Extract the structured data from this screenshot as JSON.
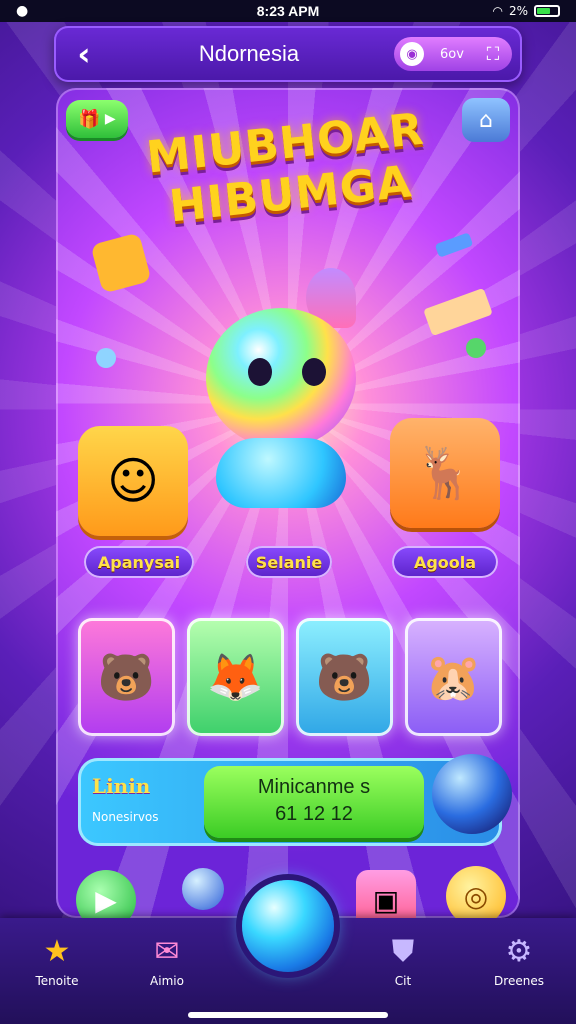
{
  "status_bar": {
    "time": "8:23 APM",
    "battery": "2%"
  },
  "header": {
    "back_icon": "‹",
    "title": "Ndornesia",
    "coin_label": "6ov",
    "coin_icon": "coin-icon",
    "cart_icon": "cart-icon"
  },
  "game": {
    "title_line1": "MIUBHOAR",
    "title_line2": "HIBUMGA",
    "characters": [
      "Apanysai",
      "Selanie",
      "Agoola"
    ]
  },
  "banner": {
    "title": "Linin",
    "subtitle": "Nonesirvos",
    "button_line1": "Minicanme s",
    "button_line2": "61 12 12"
  },
  "tabs": [
    "Tenoite",
    "Aimio",
    "Cit",
    "Dreenes"
  ],
  "colors": {
    "accent": "#ffd21e",
    "primary": "#6a2ad6",
    "button_green": "#3bcc25"
  }
}
